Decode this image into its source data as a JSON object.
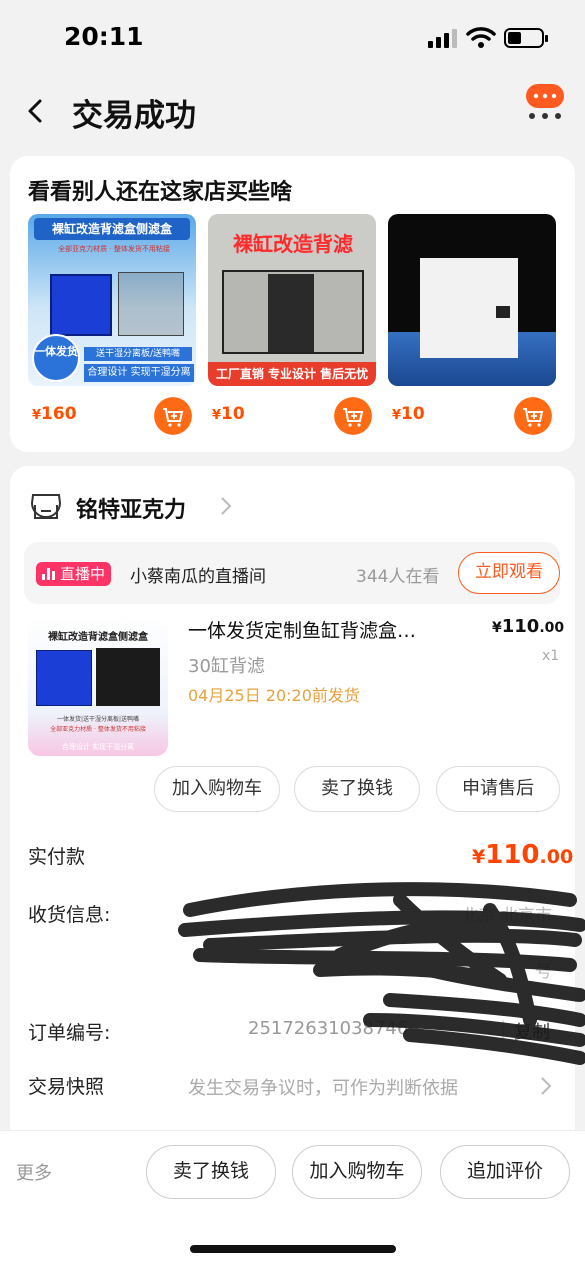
{
  "status_bar": {
    "time": "20:11"
  },
  "header": {
    "title": "交易成功"
  },
  "recommend": {
    "title": "看看别人还在这家店买些啥",
    "products": [
      {
        "price": "160",
        "currency": "¥",
        "banner": "裸缸改造背滤盒侧滤盒",
        "sub1": "全部亚克力材质 · 整体发货不用粘接",
        "badge": "一体发货",
        "strip1": "送干湿分离板/送鸭嘴",
        "strip2": "合理设计 实现干湿分离"
      },
      {
        "price": "10",
        "currency": "¥",
        "banner": "裸缸改造背滤",
        "strip": "工厂直销 专业设计 售后无忧"
      },
      {
        "price": "10",
        "currency": "¥"
      }
    ]
  },
  "store": {
    "name": "铭特亚克力"
  },
  "live": {
    "badge": "直播中",
    "room": "小蔡南瓜的直播间",
    "viewers": "344人在看",
    "watch_button": "立即观看"
  },
  "order_item": {
    "name": "一体发货定制鱼缸背滤盒…",
    "currency": "¥",
    "price_int": "110",
    "price_dec": ".00",
    "qty": "x1",
    "sku": "30缸背滤",
    "ship": "04月25日 20:20前发货",
    "thumb_title": "裸缸改造背滤盒侧滤盒",
    "thumb_sub": "一体发货|送干湿分离板|送鸭嘴",
    "thumb_sub2": "全部亚克力材质 · 整体发货不用粘接",
    "thumb_sub3": "合理设计 实现干湿分离"
  },
  "item_actions": [
    "加入购物车",
    "卖了换钱",
    "申请售后"
  ],
  "details": {
    "paid_label": "实付款",
    "paid_currency": "¥",
    "paid_int": "110",
    "paid_dec": ".00",
    "address_label": "收货信息:",
    "address_lines": [
      "北京 北京市",
      "号"
    ],
    "order_no_label": "订单编号:",
    "order_no": "25172631038746",
    "copy": "复制",
    "snapshot_label": "交易快照",
    "snapshot_desc": "发生交易争议时，可作为判断依据"
  },
  "bottom_bar": {
    "more": "更多",
    "buttons": [
      "卖了换钱",
      "加入购物车",
      "追加评价"
    ]
  },
  "colors": {
    "accent": "#ff5000",
    "live": "#ff3366",
    "ship": "#e8a23c"
  }
}
